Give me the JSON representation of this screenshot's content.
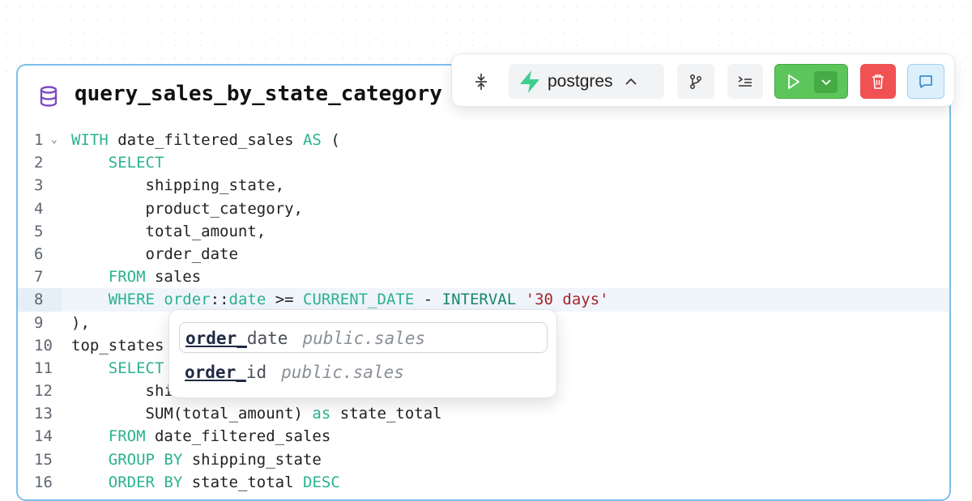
{
  "card": {
    "title": "query_sales_by_state_category"
  },
  "editor": {
    "lines": [
      {
        "no": "1",
        "fold": "⌄",
        "tokens": [
          {
            "t": "WITH",
            "c": "kw"
          },
          {
            "t": " date_filtered_sales ",
            "c": ""
          },
          {
            "t": "AS",
            "c": "kw"
          },
          {
            "t": " (",
            "c": ""
          }
        ]
      },
      {
        "no": "2",
        "tokens": [
          {
            "t": "    ",
            "c": ""
          },
          {
            "t": "SELECT",
            "c": "kw"
          }
        ]
      },
      {
        "no": "3",
        "tokens": [
          {
            "t": "        shipping_state,",
            "c": ""
          }
        ]
      },
      {
        "no": "4",
        "tokens": [
          {
            "t": "        product_category,",
            "c": ""
          }
        ]
      },
      {
        "no": "5",
        "tokens": [
          {
            "t": "        total_amount,",
            "c": ""
          }
        ]
      },
      {
        "no": "6",
        "tokens": [
          {
            "t": "        order_date",
            "c": ""
          }
        ]
      },
      {
        "no": "7",
        "tokens": [
          {
            "t": "    ",
            "c": ""
          },
          {
            "t": "FROM",
            "c": "kw"
          },
          {
            "t": " sales",
            "c": ""
          }
        ]
      },
      {
        "no": "8",
        "active": true,
        "tokens": [
          {
            "t": "    ",
            "c": ""
          },
          {
            "t": "WHERE",
            "c": "kw"
          },
          {
            "t": " ",
            "c": ""
          },
          {
            "t": "order",
            "c": "kw"
          },
          {
            "t": "::",
            "c": ""
          },
          {
            "t": "date",
            "c": "kw"
          },
          {
            "t": " >= ",
            "c": ""
          },
          {
            "t": "CURRENT_DATE",
            "c": "kw"
          },
          {
            "t": " - ",
            "c": ""
          },
          {
            "t": "INTERVAL",
            "c": "kw2"
          },
          {
            "t": " ",
            "c": ""
          },
          {
            "t": "'30 days'",
            "c": "str"
          }
        ]
      },
      {
        "no": "9",
        "tokens": [
          {
            "t": "),",
            "c": ""
          }
        ]
      },
      {
        "no": "10",
        "tokens": [
          {
            "t": "top_states",
            "c": ""
          }
        ]
      },
      {
        "no": "11",
        "tokens": [
          {
            "t": "    ",
            "c": ""
          },
          {
            "t": "SELECT",
            "c": "kw"
          }
        ]
      },
      {
        "no": "12",
        "tokens": [
          {
            "t": "        shi",
            "c": ""
          }
        ]
      },
      {
        "no": "13",
        "tokens": [
          {
            "t": "        SUM(total_amount) ",
            "c": ""
          },
          {
            "t": "as",
            "c": "kw"
          },
          {
            "t": " state_total",
            "c": ""
          }
        ]
      },
      {
        "no": "14",
        "tokens": [
          {
            "t": "    ",
            "c": ""
          },
          {
            "t": "FROM",
            "c": "kw"
          },
          {
            "t": " date_filtered_sales",
            "c": ""
          }
        ]
      },
      {
        "no": "15",
        "tokens": [
          {
            "t": "    ",
            "c": ""
          },
          {
            "t": "GROUP BY",
            "c": "kw"
          },
          {
            "t": " shipping_state",
            "c": ""
          }
        ]
      },
      {
        "no": "16",
        "tokens": [
          {
            "t": "    ",
            "c": ""
          },
          {
            "t": "ORDER BY",
            "c": "kw"
          },
          {
            "t": " state_total ",
            "c": ""
          },
          {
            "t": "DESC",
            "c": "kw"
          }
        ]
      }
    ]
  },
  "toolbar": {
    "database": "postgres"
  },
  "autocomplete": {
    "items": [
      {
        "match": "order_",
        "rest": "date",
        "hint": "public.sales"
      },
      {
        "match": "order_",
        "rest": "id",
        "hint": "public.sales"
      }
    ]
  },
  "colors": {
    "accent_border": "#7cc0ea",
    "keyword": "#2bb290",
    "string": "#a3262c",
    "run": "#5cc65a",
    "delete": "#f05153",
    "brand": "#3ecf8e"
  }
}
